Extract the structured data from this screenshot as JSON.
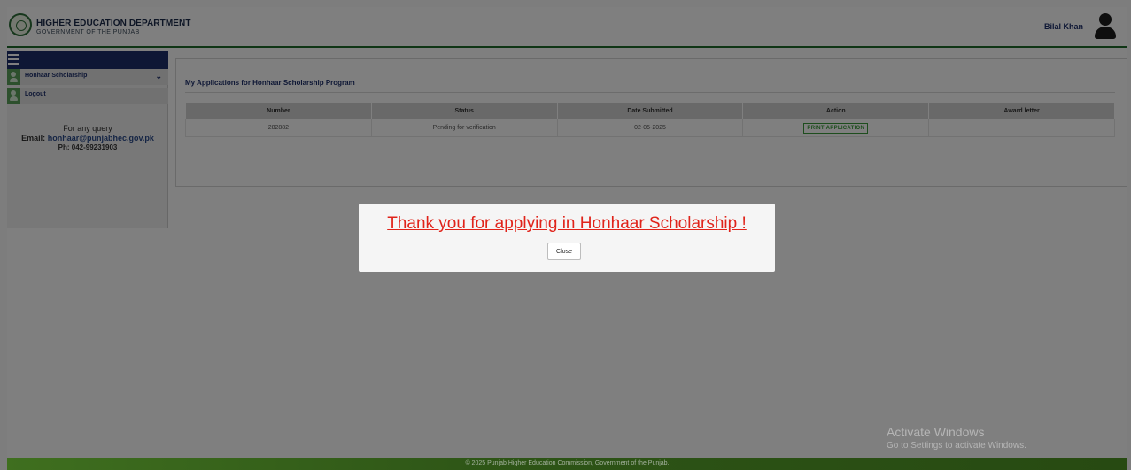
{
  "header": {
    "dept_name": "HIGHER EDUCATION DEPARTMENT",
    "dept_sub": "GOVERNMENT OF THE PUNJAB",
    "user_name": "Bilal Khan"
  },
  "sidebar": {
    "items": [
      {
        "label": "Honhaar Scholarship",
        "icon": "user-icon"
      },
      {
        "label": "Logout",
        "icon": "user-icon"
      }
    ],
    "query_text": "For any query",
    "email_label": "Email:",
    "email": "honhaar@punjabhec.gov.pk",
    "phone": "Ph: 042-99231903"
  },
  "main": {
    "title": "My Applications for Honhaar Scholarship Program",
    "columns": [
      "Number",
      "Status",
      "Date Submitted",
      "Action",
      "Award letter"
    ],
    "rows": [
      {
        "number": "282882",
        "status": "Pending for verification",
        "date": "02-05-2025",
        "action": "PRINT APPLICATION",
        "award": ""
      }
    ]
  },
  "modal": {
    "message": "Thank you for applying in Honhaar Scholarship !",
    "close_label": "Close"
  },
  "footer": {
    "text": "© 2025 Punjab Higher Education Commission, Government of the Punjab."
  },
  "watermark": {
    "title": "Activate Windows",
    "subtitle": "Go to Settings to activate Windows."
  },
  "colors": {
    "navy": "#1d2f6b",
    "green": "#1f6b2a",
    "alert_red": "#e0231a"
  }
}
